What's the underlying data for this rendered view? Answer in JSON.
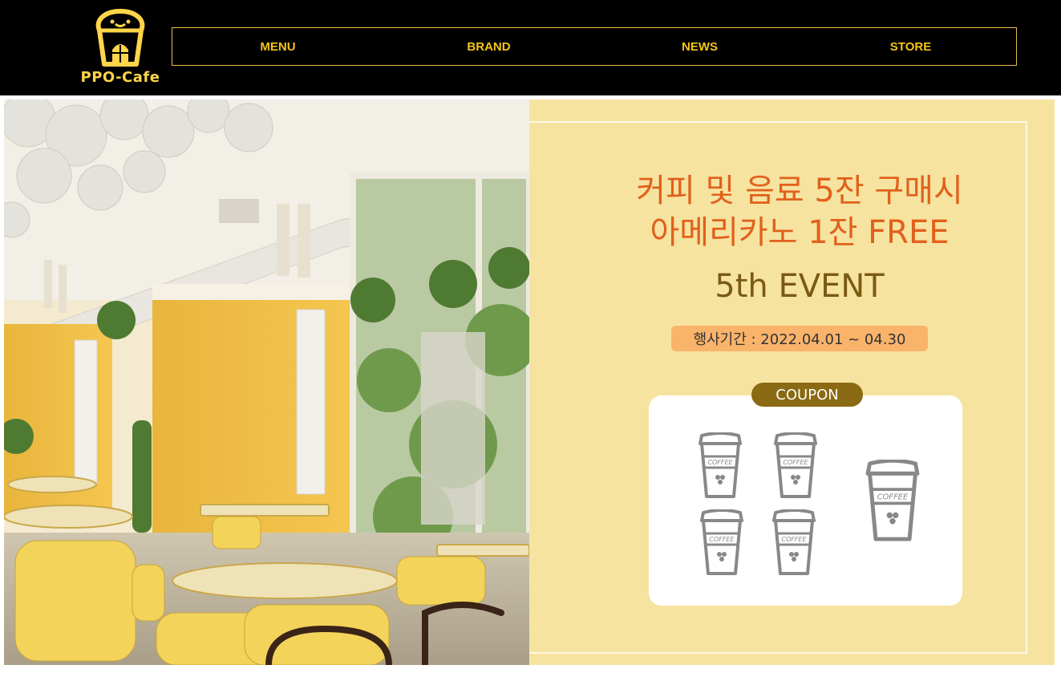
{
  "header": {
    "logo_text": "PPO-Cafe",
    "nav": [
      "MENU",
      "BRAND",
      "NEWS",
      "STORE"
    ]
  },
  "promo": {
    "title_line1": "커피 및 음료 5잔 구매시",
    "title_line2": "아메리카노 1잔 FREE",
    "event": "5th EVENT",
    "period": "행사기간 : 2022.04.01 ~ 04.30",
    "coupon_label": "COUPON",
    "cup_label": "COFFEE"
  },
  "colors": {
    "header_bg": "#000000",
    "accent_yellow": "#f5c518",
    "promo_bg": "#f7e3a0",
    "title_orange": "#e0611c",
    "event_brown": "#7a5a12",
    "period_bg": "#f9b36a"
  },
  "icons": {
    "logo": "cafe-house-icon",
    "cup": "coffee-cup-icon"
  }
}
